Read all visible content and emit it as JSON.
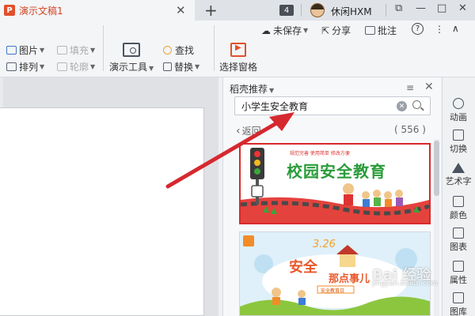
{
  "titlebar": {
    "doc_icon": "P",
    "tab_label": "演示文稿1",
    "close_glyph": "✕",
    "new_tab_glyph": "+",
    "tab_count": "4",
    "user_name": "休闲HXM",
    "window_controls": [
      "⧉",
      "—",
      "□",
      "✕"
    ]
  },
  "ribbon": {
    "status": {
      "unsaved": "未保存",
      "share": "分享",
      "comment": "批注",
      "help": "?",
      "more": "⋮",
      "collapse": "∧"
    },
    "picture": "图片",
    "fill": "填充",
    "arrange": "排列",
    "outline": "轮廓",
    "present_tools": "演示工具",
    "find": "查找",
    "replace": "替换",
    "select_pane": "选择窗格"
  },
  "pane": {
    "title": "稻壳推荐",
    "menu_glyph": "≡",
    "close_glyph": "✕",
    "search": {
      "value": "小学生安全教育",
      "clear_glyph": "✕"
    },
    "back": "返回",
    "count": "( 556 )",
    "cards": [
      {
        "title": "校园安全教育",
        "tagline": "规范完善  使用简单  修改方便"
      },
      {
        "date": "3.26",
        "title_line1": "安全",
        "title_line2": "那点事儿",
        "subtitle": "安全教育日"
      }
    ]
  },
  "sidebar": {
    "items": [
      "动画",
      "切换",
      "艺术字",
      "颜色",
      "图表",
      "属性",
      "图库"
    ]
  },
  "watermark": {
    "logo": "Bai 经验",
    "url": "jingyan.baidu.com"
  },
  "colors": {
    "accent": "#d04423",
    "arrow": "#d6282f",
    "card_border": "#d72a2a"
  }
}
